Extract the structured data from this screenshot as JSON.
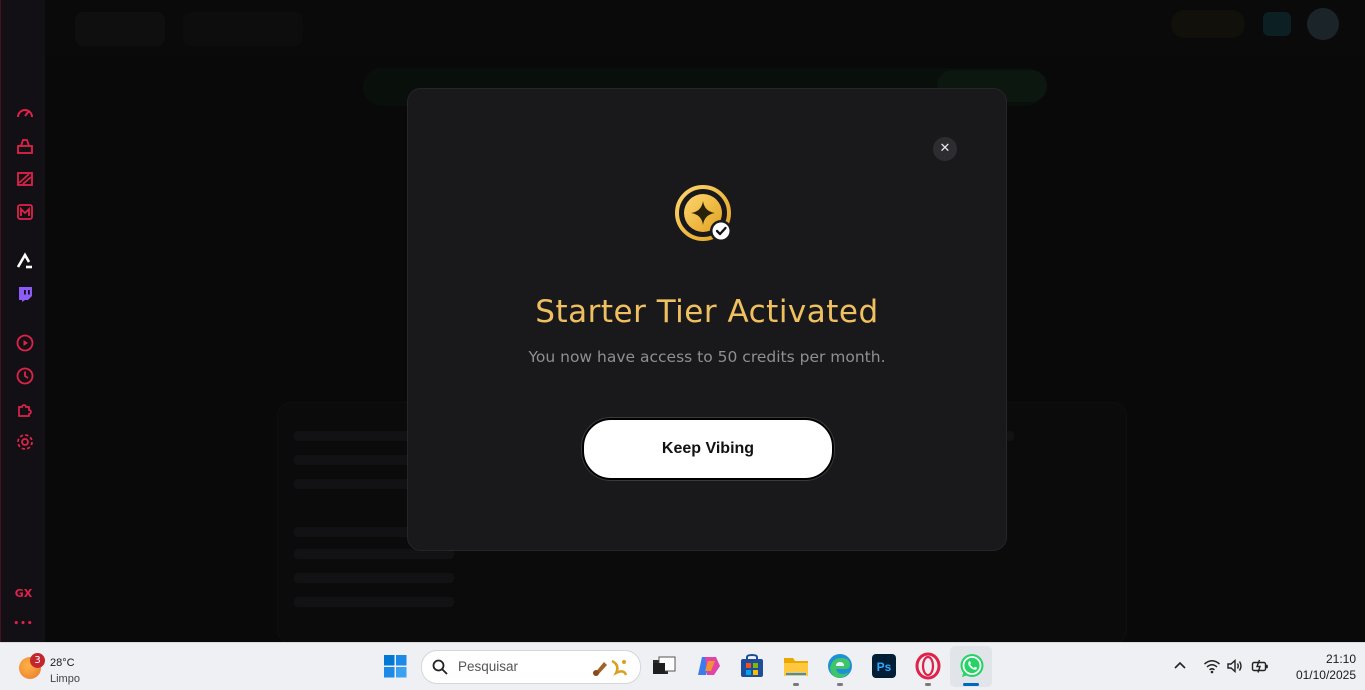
{
  "modal": {
    "title": "Starter Tier Activated",
    "subtitle": "You now have access to 50 credits per month.",
    "button_label": "Keep Vibing",
    "close_symbol": "✕",
    "icon": "sparkle-check-badge-icon",
    "title_color": "#f0c060"
  },
  "sidebar": {
    "items": [
      "speed-dial-icon",
      "easy-setup-icon",
      "flow-icon",
      "gx-corner-icon",
      "ai-app-icon",
      "twitch-icon",
      "player-icon",
      "history-icon",
      "extensions-icon",
      "settings-icon"
    ],
    "gx_label": "GX",
    "more_symbol": "•••",
    "accent": "#e0224a"
  },
  "taskbar": {
    "weather": {
      "badge": "3",
      "temp": "28°C",
      "condition": "Limpo"
    },
    "search_placeholder": "Pesquisar",
    "apps": [
      "task-view-icon",
      "copilot-icon",
      "store-icon",
      "file-explorer-icon",
      "edge-icon",
      "photoshop-icon",
      "opera-icon",
      "whatsapp-icon"
    ],
    "tray": [
      "chevron-up-icon",
      "wifi-icon",
      "volume-icon",
      "battery-icon"
    ],
    "time": "21:10",
    "date": "01/10/2025"
  }
}
